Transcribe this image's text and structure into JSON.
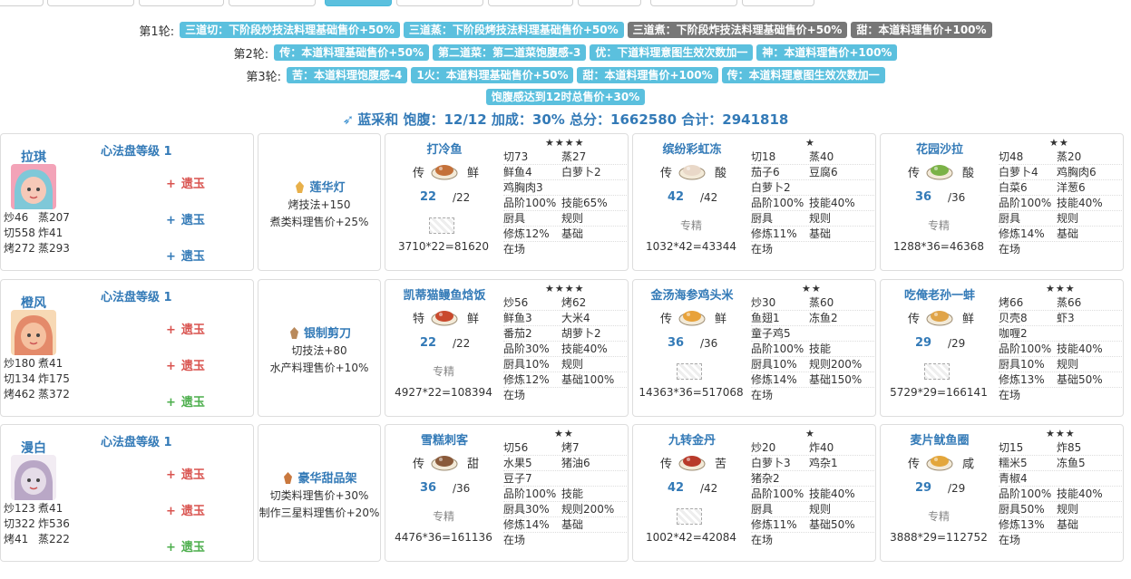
{
  "rounds": [
    {
      "label": "第1轮:",
      "badges": [
        {
          "text": "三道切：下阶段炒技法料理基础售价+50%",
          "color": "blue"
        },
        {
          "text": "三道蒸：下阶段烤技法料理基础售价+50%",
          "color": "blue"
        },
        {
          "text": "三道煮：下阶段炸技法料理基础售价+50%",
          "color": "gray"
        },
        {
          "text": "甜：本道料理售价+100%",
          "color": "gray"
        }
      ]
    },
    {
      "label": "第2轮:",
      "badges": [
        {
          "text": "传：本道料理基础售价+50%",
          "color": "blue"
        },
        {
          "text": "第二道菜：第二道菜饱腹感-3",
          "color": "blue"
        },
        {
          "text": "优：下道料理意图生效次数加一",
          "color": "blue"
        },
        {
          "text": "神：本道料理售价+100%",
          "color": "blue"
        }
      ]
    },
    {
      "label": "第3轮:",
      "badges": [
        {
          "text": "苦：本道料理饱腹感-4",
          "color": "blue"
        },
        {
          "text": "1火：本道料理基础售价+50%",
          "color": "blue"
        },
        {
          "text": "甜：本道料理售价+100%",
          "color": "blue"
        },
        {
          "text": "传：本道料理意图生效次数加一",
          "color": "blue"
        }
      ]
    },
    {
      "label": "",
      "badges": [
        {
          "text": "饱腹感达到12时总售价+30%",
          "color": "blue"
        }
      ]
    }
  ],
  "summary": "蓝采和 饱腹：12/12 加成：30% 总分：1662580 合计：2941818",
  "jade_label": "遗玉",
  "rows": [
    {
      "chef": {
        "name": "拉琪",
        "level": "心法盘等级 1",
        "stats": [
          [
            "炒46",
            "蒸207"
          ],
          [
            "切558",
            "炸41"
          ],
          [
            "烤272",
            "蒸293"
          ]
        ],
        "jades": [
          {
            "sign": "+",
            "color": "red"
          },
          {
            "sign": "+",
            "color": "blue"
          },
          {
            "sign": "+",
            "color": "blue"
          }
        ],
        "avatar_colors": [
          "#f6c9b8",
          "#7fc8d8",
          "#f3a3b8"
        ]
      },
      "equip": {
        "name": "莲华灯",
        "icon_color": "#e8b04a",
        "lines": [
          "烤技法+150",
          "煮类料理售价+25%"
        ]
      },
      "recipes": [
        {
          "name": "打冷鱼",
          "stars": "★★★★",
          "tag": "传",
          "flavor": "鲜",
          "qty": "22",
          "max": "/22",
          "footer": "broken",
          "total": "3710*22=81620",
          "dish": "#c4713a",
          "grid": [
            [
              "切73",
              "蒸27"
            ],
            [
              "鲜鱼4",
              "白萝卜2"
            ],
            [
              "鸡胸肉3",
              ""
            ],
            [
              "品阶100%",
              "技能65%"
            ],
            [
              "厨具",
              "规则"
            ],
            [
              "修炼12%",
              "基础"
            ],
            [
              "在场",
              ""
            ]
          ]
        },
        {
          "name": "缤纷彩虹冻",
          "stars": "★",
          "tag": "传",
          "flavor": "酸",
          "qty": "42",
          "max": "/42",
          "footer": "专精",
          "total": "1032*42=43344",
          "dish": "#e9d8c8",
          "grid": [
            [
              "切18",
              "蒸40"
            ],
            [
              "茄子6",
              "豆腐6"
            ],
            [
              "白萝卜2",
              ""
            ],
            [
              "品阶100%",
              "技能40%"
            ],
            [
              "厨具",
              "规则"
            ],
            [
              "修炼11%",
              "基础"
            ],
            [
              "在场",
              ""
            ]
          ]
        },
        {
          "name": "花园沙拉",
          "stars": "★★",
          "tag": "传",
          "flavor": "酸",
          "qty": "36",
          "max": "/36",
          "footer": "专精",
          "total": "1288*36=46368",
          "dish": "#7bb247",
          "grid": [
            [
              "切48",
              "蒸20"
            ],
            [
              "白萝卜4",
              "鸡胸肉6"
            ],
            [
              "白菜6",
              "洋葱6"
            ],
            [
              "品阶100%",
              "技能40%"
            ],
            [
              "厨具",
              "规则"
            ],
            [
              "修炼14%",
              "基础"
            ],
            [
              "在场",
              ""
            ]
          ]
        }
      ]
    },
    {
      "chef": {
        "name": "橙风",
        "level": "心法盘等级 1",
        "stats": [
          [
            "炒180",
            "煮41"
          ],
          [
            "切134",
            "炸175"
          ],
          [
            "烤462",
            "蒸372"
          ]
        ],
        "jades": [
          {
            "sign": "+",
            "color": "red"
          },
          {
            "sign": "+",
            "color": "red"
          },
          {
            "sign": "+",
            "color": "green"
          }
        ],
        "avatar_colors": [
          "#f5c1a0",
          "#e48a6a",
          "#f7d9b5"
        ]
      },
      "equip": {
        "name": "银制剪刀",
        "icon_color": "#b98a5c",
        "lines": [
          "切技法+80",
          "水产料理售价+10%"
        ]
      },
      "recipes": [
        {
          "name": "凯蒂猫鳗鱼焓饭",
          "stars": "★★★★",
          "tag": "特",
          "flavor": "鲜",
          "qty": "22",
          "max": "/22",
          "footer": "专精",
          "total": "4927*22=108394",
          "dish": "#c9492d",
          "grid": [
            [
              "炒56",
              "烤62"
            ],
            [
              "鲜鱼3",
              "大米4"
            ],
            [
              "番茄2",
              "胡萝卜2"
            ],
            [
              "品阶30%",
              "技能40%"
            ],
            [
              "厨具10%",
              "规则"
            ],
            [
              "修炼12%",
              "基础100%"
            ],
            [
              "在场",
              ""
            ]
          ]
        },
        {
          "name": "金汤海参鸡头米",
          "stars": "★★",
          "tag": "传",
          "flavor": "鲜",
          "qty": "36",
          "max": "/36",
          "footer": "broken",
          "total": "14363*36=517068",
          "dish": "#e8a23a",
          "grid": [
            [
              "炒30",
              "蒸60"
            ],
            [
              "鱼翅1",
              "冻鱼2"
            ],
            [
              "童子鸡5",
              ""
            ],
            [
              "品阶100%",
              "技能"
            ],
            [
              "厨具10%",
              "规则200%"
            ],
            [
              "修炼14%",
              "基础150%"
            ],
            [
              "在场",
              ""
            ]
          ]
        },
        {
          "name": "吃俺老孙一蚌",
          "stars": "★★★",
          "tag": "传",
          "flavor": "鲜",
          "qty": "29",
          "max": "/29",
          "footer": "broken",
          "total": "5729*29=166141",
          "dish": "#e0a448",
          "grid": [
            [
              "烤66",
              "蒸66"
            ],
            [
              "贝壳8",
              "虾3"
            ],
            [
              "咖喱2",
              ""
            ],
            [
              "品阶100%",
              "技能40%"
            ],
            [
              "厨具10%",
              "规则"
            ],
            [
              "修炼13%",
              "基础50%"
            ],
            [
              "在场",
              ""
            ]
          ]
        }
      ]
    },
    {
      "chef": {
        "name": "漫白",
        "level": "心法盘等级 1",
        "stats": [
          [
            "炒123",
            "煮41"
          ],
          [
            "切322",
            "炸536"
          ],
          [
            "烤41",
            "蒸222"
          ]
        ],
        "jades": [
          {
            "sign": "+",
            "color": "red"
          },
          {
            "sign": "+",
            "color": "red"
          },
          {
            "sign": "+",
            "color": "green"
          }
        ],
        "avatar_colors": [
          "#e5dce8",
          "#b9a7c6",
          "#f2ecf3"
        ]
      },
      "equip": {
        "name": "豪华甜品架",
        "icon_color": "#c9783e",
        "lines": [
          "切类料理售价+30%",
          "制作三星料理售价+20%"
        ]
      },
      "recipes": [
        {
          "name": "雪糕刺客",
          "stars": "★★",
          "tag": "传",
          "flavor": "甜",
          "qty": "36",
          "max": "/36",
          "footer": "专精",
          "total": "4476*36=161136",
          "dish": "#8a5a3a",
          "grid": [
            [
              "切56",
              "烤7"
            ],
            [
              "水果5",
              "猪油6"
            ],
            [
              "豆子7",
              ""
            ],
            [
              "品阶100%",
              "技能"
            ],
            [
              "厨具30%",
              "规则200%"
            ],
            [
              "修炼14%",
              "基础"
            ],
            [
              "在场",
              ""
            ]
          ]
        },
        {
          "name": "九转金丹",
          "stars": "★",
          "tag": "传",
          "flavor": "苦",
          "qty": "42",
          "max": "/42",
          "footer": "broken",
          "total": "1002*42=42084",
          "dish": "#b83a2a",
          "grid": [
            [
              "炒20",
              "炸40"
            ],
            [
              "白萝卜3",
              "鸡杂1"
            ],
            [
              "猪杂2",
              ""
            ],
            [
              "品阶100%",
              "技能40%"
            ],
            [
              "厨具",
              "规则"
            ],
            [
              "修炼11%",
              "基础50%"
            ],
            [
              "在场",
              ""
            ]
          ]
        },
        {
          "name": "麦片鱿鱼圈",
          "stars": "★★★",
          "tag": "传",
          "flavor": "咸",
          "qty": "29",
          "max": "/29",
          "footer": "专精",
          "total": "3888*29=112752",
          "dish": "#e3a63b",
          "grid": [
            [
              "切15",
              "炸85"
            ],
            [
              "糯米5",
              "冻鱼5"
            ],
            [
              "青椒4",
              ""
            ],
            [
              "品阶100%",
              "技能40%"
            ],
            [
              "厨具50%",
              "规则"
            ],
            [
              "修炼13%",
              "基础"
            ],
            [
              "在场",
              ""
            ]
          ]
        }
      ]
    }
  ]
}
